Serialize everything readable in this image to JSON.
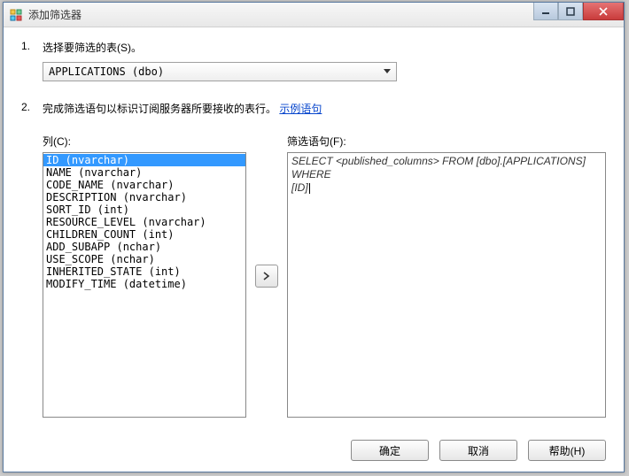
{
  "titlebar": {
    "title": "添加筛选器"
  },
  "step1": {
    "num": "1.",
    "text": "选择要筛选的表(S)。",
    "combo_value": "APPLICATIONS (dbo)"
  },
  "step2": {
    "num": "2.",
    "text_prefix": "完成筛选语句以标识订阅服务器所要接收的表行。",
    "link_text": "示例语句"
  },
  "left": {
    "label": "列(C):",
    "items": [
      "ID (nvarchar)",
      "NAME (nvarchar)",
      "CODE_NAME (nvarchar)",
      "DESCRIPTION (nvarchar)",
      "SORT_ID (int)",
      "RESOURCE_LEVEL (nvarchar)",
      "CHILDREN_COUNT (int)",
      "ADD_SUBAPP (nchar)",
      "USE_SCOPE (nchar)",
      "INHERITED_STATE (int)",
      "MODIFY_TIME (datetime)"
    ],
    "selected_index": 0
  },
  "right": {
    "label": "筛选语句(F):",
    "line1": "SELECT <published_columns> FROM [dbo].[APPLICATIONS] WHERE",
    "line2": "[ID]"
  },
  "buttons": {
    "ok": "确定",
    "cancel": "取消",
    "help": "帮助(H)"
  }
}
